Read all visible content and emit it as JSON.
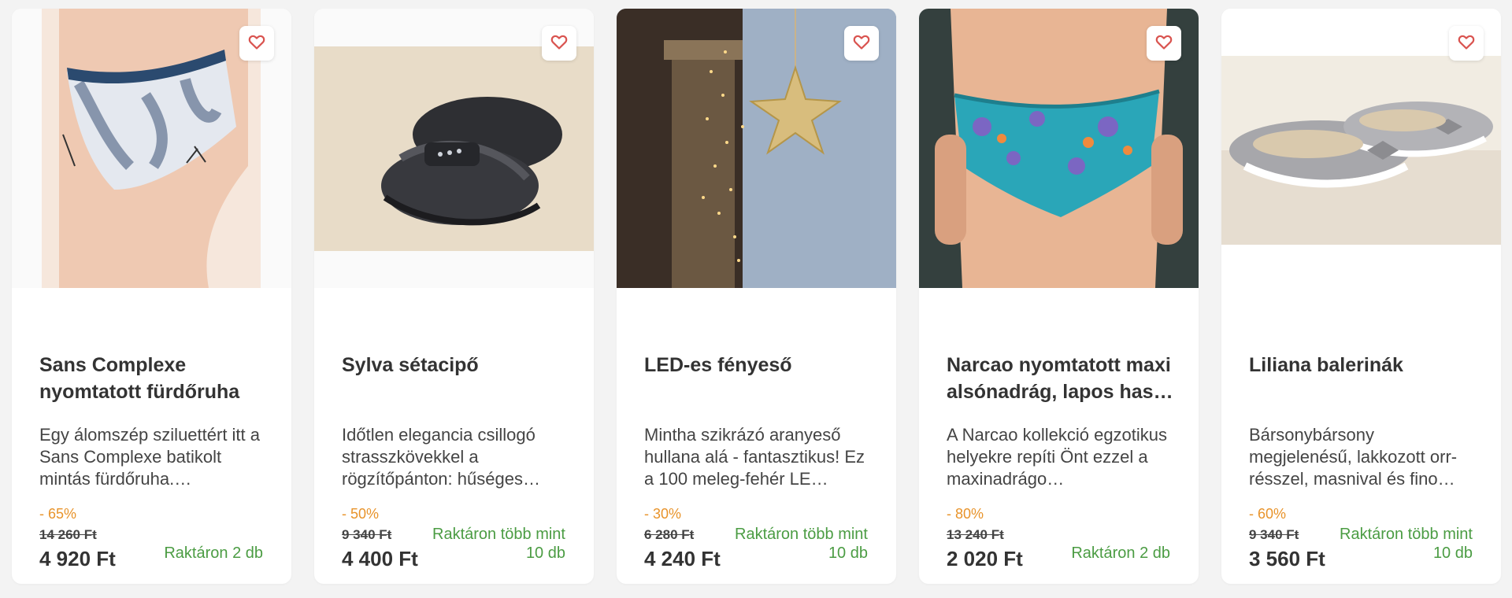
{
  "colors": {
    "background": "#f3f3f3",
    "card": "#ffffff",
    "discount": "#e8932a",
    "stock": "#4b9c43",
    "heart": "#d9534f"
  },
  "products": [
    {
      "image": "printed swimsuit bottom on model",
      "favorite_icon": "heart-outline-icon",
      "title": "Sans Complexe nyomtatott fürdőruha",
      "description": "Egy álomszép sziluettért itt a Sans Complexe batikolt mintás fürdőruha.…",
      "discount": "- 65%",
      "old_price": "14 260 Ft",
      "price": "4 920 Ft",
      "stock": "Raktáron 2 db"
    },
    {
      "image": "black leather walking shoes",
      "favorite_icon": "heart-outline-icon",
      "title": "Sylva sétacipő",
      "description": "Időtlen elegancia csillogó strasszkövekkel a rögzítőpánton: hűséges…",
      "discount": "- 50%",
      "old_price": "9 340 Ft",
      "price": "4 400 Ft",
      "stock": "Raktáron több mint 10 db"
    },
    {
      "image": "LED star light decoration",
      "favorite_icon": "heart-outline-icon",
      "title": "LED-es fényeső",
      "description": "Mintha szikrázó aranyeső hullana alá - fantasztikus! Ez a 100 meleg-fehér LE…",
      "discount": "- 30%",
      "old_price": "6 280 Ft",
      "price": "4 240 Ft",
      "stock": "Raktáron több mint 10 db"
    },
    {
      "image": "turquoise floral maxi briefs on model",
      "favorite_icon": "heart-outline-icon",
      "title": "Narcao nyomtatott maxi alsónadrág, lapos has…",
      "description": "A Narcao kollekció egzotikus helyekre repíti Önt ezzel a maxinadrágo…",
      "discount": "- 80%",
      "old_price": "13 240 Ft",
      "price": "2 020 Ft",
      "stock": "Raktáron 2 db"
    },
    {
      "image": "grey ballerina flats with bow",
      "favorite_icon": "heart-outline-icon",
      "title": "Liliana balerinák",
      "description": "Bársonybársony megjelenésű, lakkozott orr-résszel, masnival és fino…",
      "discount": "- 60%",
      "old_price": "9 340 Ft",
      "price": "3 560 Ft",
      "stock": "Raktáron több mint 10 db"
    }
  ]
}
